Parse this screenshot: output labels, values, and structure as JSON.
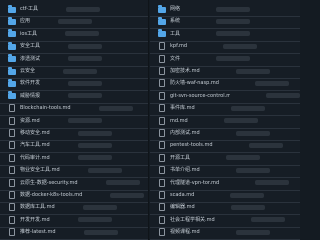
{
  "left_column": {
    "items": [
      {
        "type": "folder",
        "name": "ctf-工具"
      },
      {
        "type": "folder",
        "name": "应用"
      },
      {
        "type": "folder",
        "name": "ios工具"
      },
      {
        "type": "folder",
        "name": "安全工具"
      },
      {
        "type": "folder",
        "name": "渗透测试"
      },
      {
        "type": "folder",
        "name": "云安全"
      },
      {
        "type": "folder",
        "name": "软件开发"
      },
      {
        "type": "folder",
        "name": "威胁情报"
      },
      {
        "type": "file",
        "name": "Blockchain-tools.md"
      },
      {
        "type": "file",
        "name": "资源.md"
      },
      {
        "type": "file",
        "name": "移动安全.md"
      },
      {
        "type": "file",
        "name": "汽车工具.md"
      },
      {
        "type": "file",
        "name": "代码审计.md"
      },
      {
        "type": "file",
        "name": "物业安全工具.md"
      },
      {
        "type": "file",
        "name": "云原生-数据-security.md"
      },
      {
        "type": "file",
        "name": "数据-docker-k8s-tools.md"
      },
      {
        "type": "file",
        "name": "数据库工具.md"
      },
      {
        "type": "file",
        "name": "开发开发.md"
      },
      {
        "type": "file",
        "name": "推荐-latest.md"
      }
    ]
  },
  "right_column": {
    "items": [
      {
        "type": "folder",
        "name": "网络"
      },
      {
        "type": "folder",
        "name": "系统"
      },
      {
        "type": "folder",
        "name": "工具"
      },
      {
        "type": "file",
        "name": "kpf.md"
      },
      {
        "type": "file",
        "name": "文件"
      },
      {
        "type": "file",
        "name": "加密技术.md"
      },
      {
        "type": "file",
        "name": "防火墙-waf-nasp.md"
      },
      {
        "type": "file",
        "name": "git-svn-source-control.md"
      },
      {
        "type": "file",
        "name": "事件库.md"
      },
      {
        "type": "file",
        "name": "md.md"
      },
      {
        "type": "file",
        "name": "内部测试.md"
      },
      {
        "type": "file",
        "name": "pentest-tools.md"
      },
      {
        "type": "file",
        "name": "开源工具"
      },
      {
        "type": "file",
        "name": "书单介绍.md"
      },
      {
        "type": "file",
        "name": "代理隧道-vpn-tor.md"
      },
      {
        "type": "file",
        "name": "scada.md"
      },
      {
        "type": "file",
        "name": "编辑器.md"
      },
      {
        "type": "file",
        "name": "社会工程学相关.md"
      },
      {
        "type": "file",
        "name": "视频课程.md"
      }
    ]
  },
  "colors": {
    "background": "#141b22",
    "row_bg": "#161d25",
    "divider": "#2a323c",
    "folder": "#53a6e8",
    "text": "#c9d1d9"
  }
}
